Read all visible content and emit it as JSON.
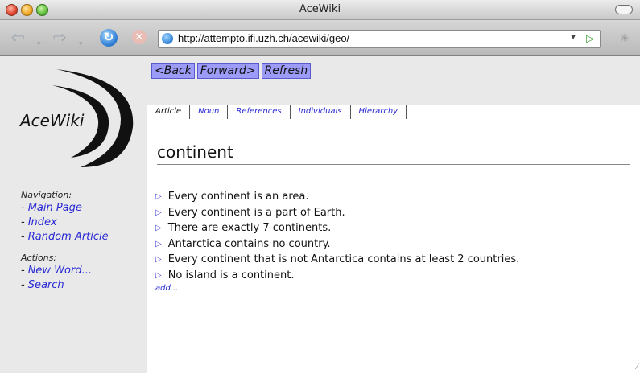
{
  "window": {
    "title": "AceWiki"
  },
  "toolbar": {
    "back_icon": "back-arrow-icon",
    "forward_icon": "forward-arrow-icon",
    "reload_icon": "reload-icon",
    "stop_icon": "stop-icon",
    "url": "http://attempto.ifi.uzh.ch/acewiki/geo/"
  },
  "nav_buttons": {
    "back": "<Back",
    "forward": "Forward>",
    "refresh": "Refresh"
  },
  "logo": {
    "text": "AceWiki"
  },
  "sidebar": {
    "navigation_heading": "Navigation:",
    "navigation_items": [
      "Main Page",
      "Index",
      "Random Article"
    ],
    "actions_heading": "Actions:",
    "action_items": [
      "New Word...",
      "Search"
    ]
  },
  "tabs": [
    "Article",
    "Noun",
    "References",
    "Individuals",
    "Hierarchy"
  ],
  "article": {
    "title": "continent",
    "sentences": [
      "Every continent is an area.",
      "Every continent is a part of Earth.",
      "There are exactly 7 continents.",
      "Antarctica contains no country.",
      "Every continent that is not Antarctica contains at least 2 countries.",
      "No island is a continent."
    ],
    "add_label": "add..."
  },
  "colors": {
    "button_bg": "#9c9cf8",
    "link": "#2828d4",
    "page_bg": "#e9e9e9"
  }
}
